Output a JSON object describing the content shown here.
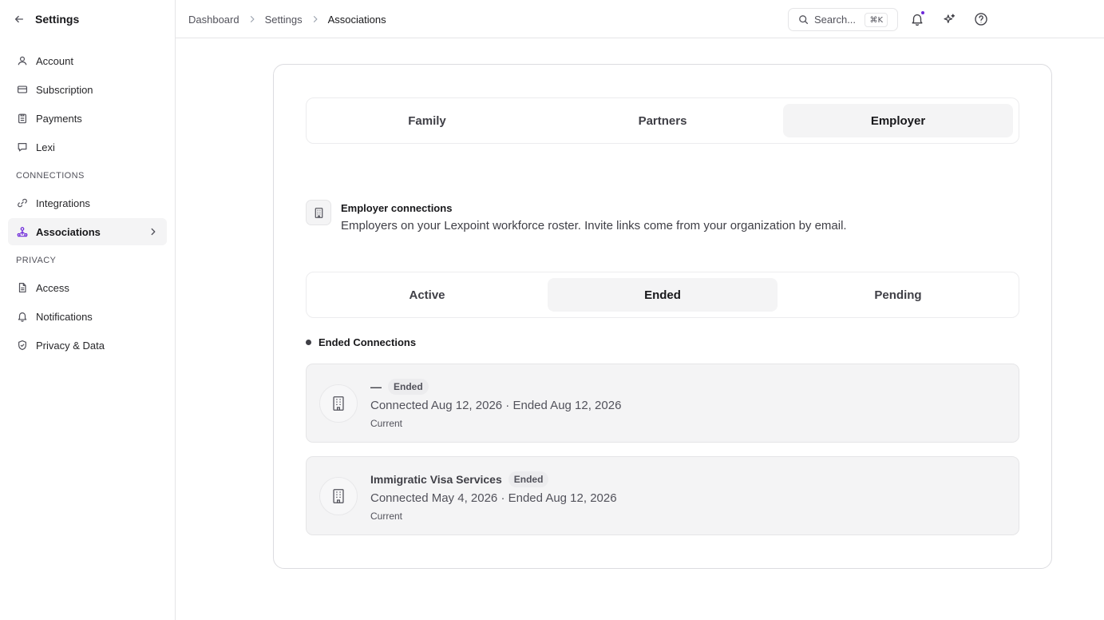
{
  "sidebar": {
    "title": "Settings",
    "items": [
      {
        "label": "Account",
        "icon": "user-icon"
      },
      {
        "label": "Subscription",
        "icon": "card-icon"
      },
      {
        "label": "Payments",
        "icon": "clipboard-icon"
      },
      {
        "label": "Lexi",
        "icon": "chat-icon"
      }
    ],
    "sections": [
      {
        "label": "CONNECTIONS",
        "items": [
          {
            "label": "Integrations",
            "icon": "link-icon"
          },
          {
            "label": "Associations",
            "icon": "network-icon",
            "active": true
          }
        ]
      },
      {
        "label": "PRIVACY",
        "items": [
          {
            "label": "Access",
            "icon": "document-icon"
          },
          {
            "label": "Notifications",
            "icon": "bell-icon"
          },
          {
            "label": "Privacy & Data",
            "icon": "shield-icon"
          }
        ]
      }
    ]
  },
  "breadcrumb": [
    "Dashboard",
    "Settings",
    "Associations"
  ],
  "search": {
    "placeholder": "Search...",
    "shortcut": "⌘K"
  },
  "colors": {
    "accent": "#6d28d9",
    "panel": "#f4f4f5",
    "border": "#e5e5e7"
  },
  "tabs": {
    "items": [
      "Family",
      "Partners",
      "Employer"
    ],
    "selected": "Employer"
  },
  "intro": {
    "title": "Employer connections",
    "description": "Employers on your Lexpoint workforce roster. Invite links come from your organization by email."
  },
  "status_tabs": {
    "items": [
      "Active",
      "Ended",
      "Pending"
    ],
    "selected": "Ended"
  },
  "section_label": "Ended Connections",
  "connections": [
    {
      "name": "—",
      "badge": "Ended",
      "dates": "Connected Aug 12, 2026 · Ended Aug 12, 2026",
      "sub": "Current"
    },
    {
      "name": "Immigratic Visa Services",
      "badge": "Ended",
      "dates": "Connected May 4, 2026 · Ended Aug 12, 2026",
      "sub": "Current"
    }
  ]
}
